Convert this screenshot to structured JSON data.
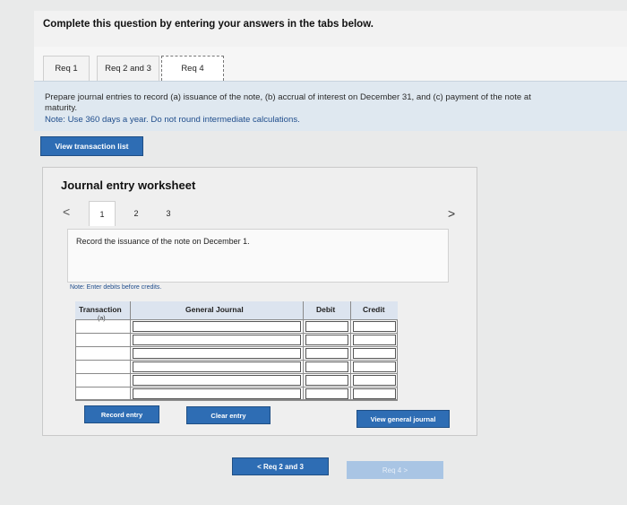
{
  "instruction": "Complete this question by entering your answers in the tabs below.",
  "tabs": [
    "Req 1",
    "Req 2 and 3",
    "Req 4"
  ],
  "prompt": {
    "line1": "Prepare journal entries to record (a) issuance of the note, (b) accrual of interest on December 31, and (c) payment of the note at",
    "line2": "maturity.",
    "note": "Note: Use 360 days a year. Do not round intermediate calculations."
  },
  "view_transaction_list": "View transaction list",
  "worksheet": {
    "title": "Journal entry worksheet",
    "prev_icon": "<",
    "next_icon": ">",
    "pages": [
      "1",
      "2",
      "3"
    ],
    "record_text": "Record the issuance of the note on December 1.",
    "note_debits": "Note: Enter debits before credits."
  },
  "table": {
    "headers": [
      "Transaction",
      "General Journal",
      "Debit",
      "Credit"
    ],
    "rows": [
      {
        "transaction": "(a)",
        "general_journal": "",
        "debit": "",
        "credit": ""
      },
      {
        "transaction": "",
        "general_journal": "",
        "debit": "",
        "credit": ""
      },
      {
        "transaction": "",
        "general_journal": "",
        "debit": "",
        "credit": ""
      },
      {
        "transaction": "",
        "general_journal": "",
        "debit": "",
        "credit": ""
      },
      {
        "transaction": "",
        "general_journal": "",
        "debit": "",
        "credit": ""
      },
      {
        "transaction": "",
        "general_journal": "",
        "debit": "",
        "credit": ""
      }
    ]
  },
  "buttons": {
    "record_entry": "Record entry",
    "clear_entry": "Clear entry",
    "view_general_journal": "View general journal"
  },
  "navigation": {
    "prev_label": "< Req 2 and 3",
    "next_label": "Req 4 >"
  }
}
